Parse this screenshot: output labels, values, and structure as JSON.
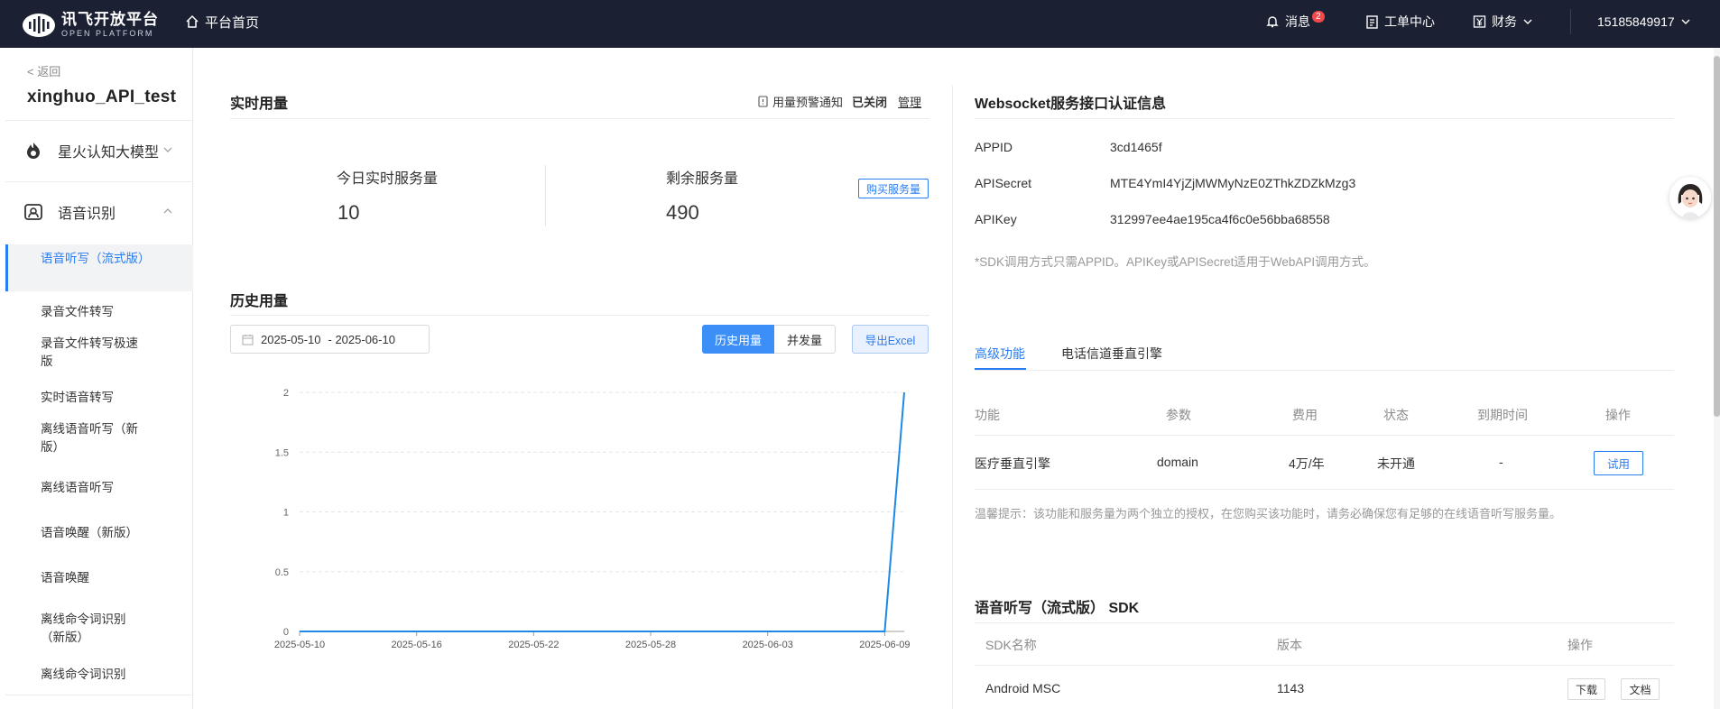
{
  "topbar": {
    "logo_cn": "讯飞开放平台",
    "logo_en": "OPEN PLATFORM",
    "home": "平台首页",
    "messages": "消息",
    "message_count": "2",
    "tickets": "工单中心",
    "finance": "财务",
    "user": "15185849917"
  },
  "sidebar": {
    "back": "< 返回",
    "app_name": "xinghuo_API_test",
    "group_spark": "星火认知大模型",
    "group_asr": "语音识别",
    "items": [
      "语音听写（流式版）",
      "录音文件转写",
      "录音文件转写极速版",
      "实时语音转写",
      "离线语音听写（新版）",
      "离线语音听写",
      "语音唤醒（新版）",
      "语音唤醒",
      "离线命令词识别（新版）",
      "离线命令词识别"
    ]
  },
  "realtime": {
    "title": "实时用量",
    "alert_label": "用量预警通知",
    "alert_status": "已关闭",
    "manage": "管理",
    "today_label": "今日实时服务量",
    "today_value": "10",
    "remain_label": "剩余服务量",
    "remain_value": "490",
    "buy": "购买服务量"
  },
  "history": {
    "title": "历史用量",
    "date_start": "2025-05-10",
    "date_end": "- 2025-06-10",
    "tab_history": "历史用量",
    "tab_concurrency": "并发量",
    "export": "导出Excel"
  },
  "chart_data": {
    "type": "line",
    "x": [
      "2025-05-10",
      "2025-05-11",
      "2025-05-12",
      "2025-05-13",
      "2025-05-14",
      "2025-05-15",
      "2025-05-16",
      "2025-05-17",
      "2025-05-18",
      "2025-05-19",
      "2025-05-20",
      "2025-05-21",
      "2025-05-22",
      "2025-05-23",
      "2025-05-24",
      "2025-05-25",
      "2025-05-26",
      "2025-05-27",
      "2025-05-28",
      "2025-05-29",
      "2025-05-30",
      "2025-05-31",
      "2025-06-01",
      "2025-06-02",
      "2025-06-03",
      "2025-06-04",
      "2025-06-05",
      "2025-06-06",
      "2025-06-07",
      "2025-06-08",
      "2025-06-09",
      "2025-06-10"
    ],
    "values": [
      0,
      0,
      0,
      0,
      0,
      0,
      0,
      0,
      0,
      0,
      0,
      0,
      0,
      0,
      0,
      0,
      0,
      0,
      0,
      0,
      0,
      0,
      0,
      0,
      0,
      0,
      0,
      0,
      0,
      0,
      0,
      2
    ],
    "x_tick_labels": [
      "2025-05-10",
      "2025-05-16",
      "2025-05-22",
      "2025-05-28",
      "2025-06-03",
      "2025-06-09"
    ],
    "y_ticks": [
      "0",
      "0.5",
      "1",
      "1.5",
      "2"
    ],
    "ylim": [
      0,
      2
    ],
    "grid": true,
    "line_color": "#1e88e5"
  },
  "auth": {
    "title": "Websocket服务接口认证信息",
    "appid_key": "APPID",
    "appid_val": "3cd1465f",
    "secret_key": "APISecret",
    "secret_val": "MTE4YmI4YjZjMWMyNzE0ZThkZDZkMzg3",
    "apikey_key": "APIKey",
    "apikey_val": "312997ee4ae195ca4f6c0e56bba68558",
    "note": "*SDK调用方式只需APPID。APIKey或APISecret适用于WebAPI调用方式。"
  },
  "advanced": {
    "tab_advanced": "高级功能",
    "tab_phone": "电话信道垂直引擎",
    "headers": [
      "功能",
      "参数",
      "费用",
      "状态",
      "到期时间",
      "操作"
    ],
    "row": [
      "医疗垂直引擎",
      "domain",
      "4万/年",
      "未开通",
      "-"
    ],
    "try": "试用",
    "tip": "温馨提示：该功能和服务量为两个独立的授权，在您购买该功能时，请务必确保您有足够的在线语音听写服务量。"
  },
  "sdk": {
    "title": "语音听写（流式版） SDK",
    "headers": [
      "SDK名称",
      "版本",
      "操作"
    ],
    "row": [
      "Android MSC",
      "1143"
    ],
    "download": "下载",
    "docs": "文档"
  },
  "colors": {
    "accent": "#2a7cf1",
    "topbar": "#1b2133"
  }
}
